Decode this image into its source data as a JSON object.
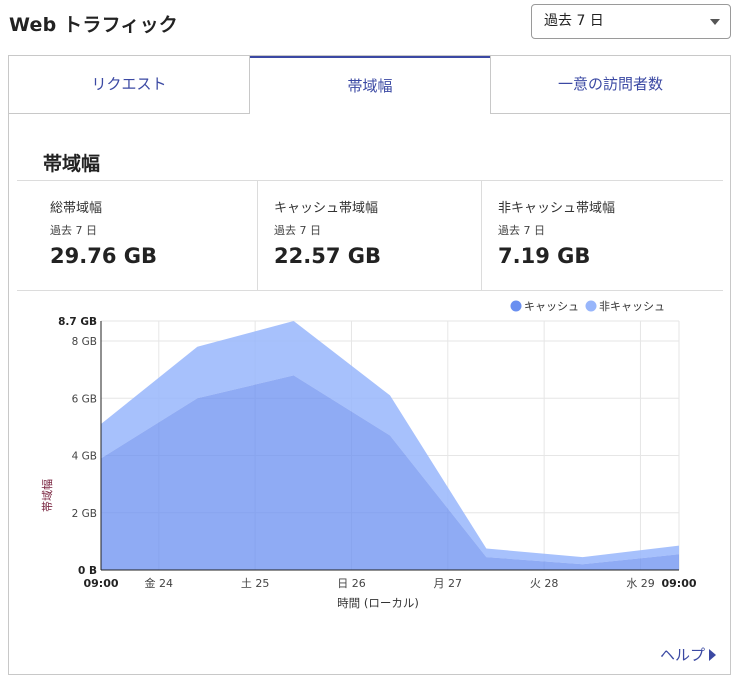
{
  "header": {
    "title": "Web トラフィック"
  },
  "range_select": {
    "value": "過去 7 日"
  },
  "tabs": [
    {
      "label": "リクエスト",
      "active": false
    },
    {
      "label": "帯域幅",
      "active": true
    },
    {
      "label": "一意の訪問者数",
      "active": false
    }
  ],
  "section": {
    "title": "帯域幅"
  },
  "stats": [
    {
      "label": "総帯域幅",
      "period": "過去 7 日",
      "value": "29.76 GB"
    },
    {
      "label": "キャッシュ帯域幅",
      "period": "過去 7 日",
      "value": "22.57 GB"
    },
    {
      "label": "非キャッシュ帯域幅",
      "period": "過去 7 日",
      "value": "7.19 GB"
    }
  ],
  "help": {
    "label": "ヘルプ"
  },
  "colors": {
    "accent": "#3b49a3",
    "cached": "#6a8ff0",
    "uncached": "#98b6fb"
  },
  "chart_data": {
    "type": "area",
    "stacked": true,
    "ylabel": "帯域幅",
    "xlabel": "時間 (ローカル)",
    "ylim": [
      0,
      8.7
    ],
    "y_ticks": [
      {
        "value": 0,
        "label": "0 B"
      },
      {
        "value": 2,
        "label": "2 GB"
      },
      {
        "value": 4,
        "label": "4 GB"
      },
      {
        "value": 6,
        "label": "6 GB"
      },
      {
        "value": 8,
        "label": "8 GB"
      },
      {
        "value": 8.7,
        "label": "8.7 GB"
      }
    ],
    "x_ticks": [
      {
        "pos": 0,
        "label": "09:00"
      },
      {
        "pos": 0.6,
        "label": "金 24"
      },
      {
        "pos": 1.6,
        "label": "土 25"
      },
      {
        "pos": 2.6,
        "label": "日 26"
      },
      {
        "pos": 3.6,
        "label": "月 27"
      },
      {
        "pos": 4.6,
        "label": "火 28"
      },
      {
        "pos": 5.6,
        "label": "水 29"
      },
      {
        "pos": 6,
        "label": "09:00"
      }
    ],
    "x": [
      0,
      1,
      2,
      3,
      4,
      5,
      6
    ],
    "series": [
      {
        "name": "キャッシュ",
        "values": [
          3.9,
          6.0,
          6.8,
          4.7,
          0.45,
          0.2,
          0.55
        ]
      },
      {
        "name": "非キャッシュ",
        "values": [
          1.2,
          1.8,
          1.9,
          1.4,
          0.3,
          0.25,
          0.3
        ]
      }
    ],
    "legend": "top-right",
    "grid": true
  }
}
